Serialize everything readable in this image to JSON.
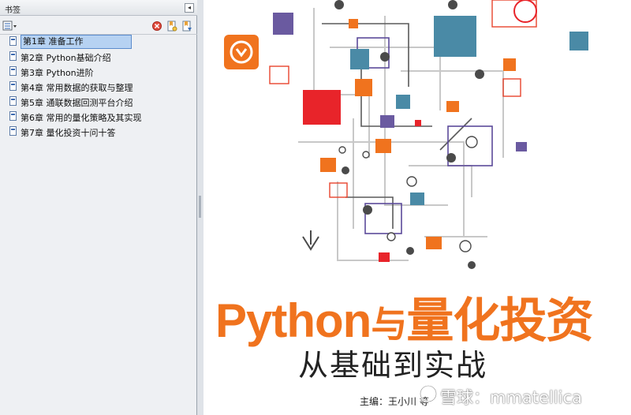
{
  "panel": {
    "title": "书签",
    "collapse_icon": "chevron-left-icon",
    "items": [
      {
        "label": "第1章 准备工作"
      },
      {
        "label": "第2章 Python基础介绍"
      },
      {
        "label": "第3章 Python进阶"
      },
      {
        "label": "第4章 常用数据的获取与整理"
      },
      {
        "label": "第5章 通联数据回测平台介绍"
      },
      {
        "label": "第6章 常用的量化策略及其实现"
      },
      {
        "label": "第7章 量化投资十问十答"
      }
    ]
  },
  "cover": {
    "title_main": "Python",
    "title_joiner": "与",
    "title_rest": "量化投资",
    "subtitle": "从基础到实战",
    "author": "主编：王小川  等",
    "accent": "#f0731e"
  },
  "watermark": {
    "text": "雪球：mmatellica"
  }
}
